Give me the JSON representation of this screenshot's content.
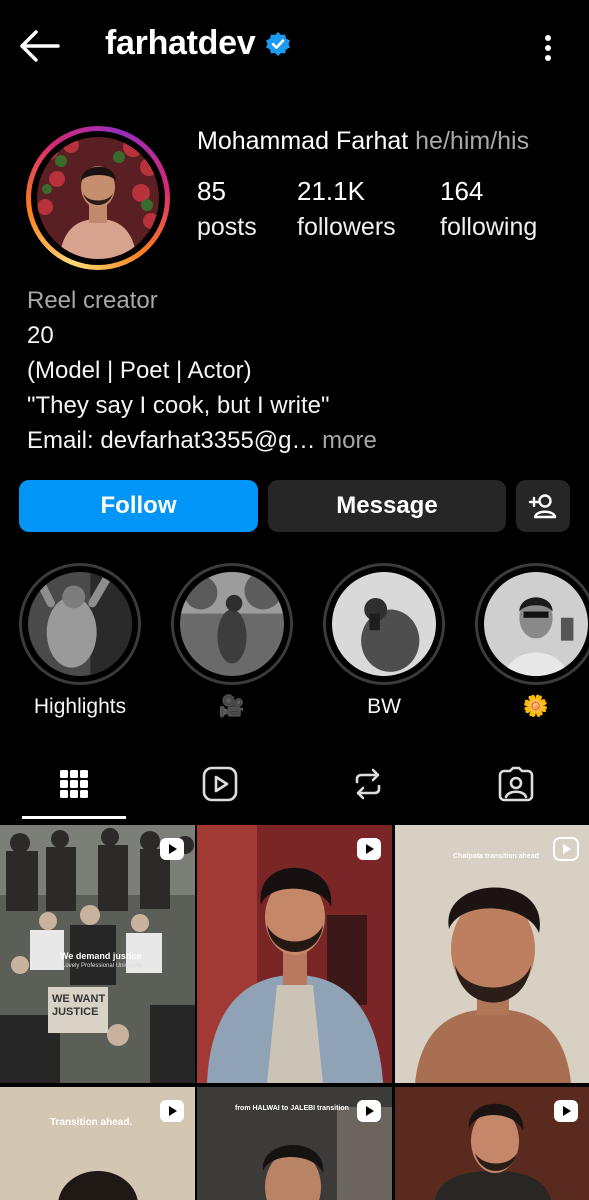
{
  "header": {
    "username": "farhatdev",
    "icons": {
      "back": "arrow-left-icon",
      "verified": "verified-badge-icon",
      "menu": "more-vertical-icon"
    }
  },
  "profile": {
    "full_name": "Mohammad Farhat",
    "pronouns": "he/him/his",
    "stats": [
      {
        "value": "85",
        "label": "posts"
      },
      {
        "value": "21.1K",
        "label": "followers"
      },
      {
        "value": "164",
        "label": "following"
      }
    ],
    "bio": {
      "category": "Reel creator",
      "lines": [
        "20",
        "(Model | Poet | Actor)",
        "\"They say I cook, but I write\""
      ],
      "email_line": "Email: devfarhat3355@g…",
      "more": " more"
    }
  },
  "actions": {
    "follow": "Follow",
    "message": "Message",
    "add_icon": "person-add-icon",
    "colors": {
      "follow": "#0095f6",
      "secondary": "#262626"
    }
  },
  "highlights": [
    {
      "label": "Highlights"
    },
    {
      "label": "🎥"
    },
    {
      "label": "BW"
    },
    {
      "label": "🌼"
    }
  ],
  "tabs": [
    {
      "icon": "grid-icon",
      "active": true
    },
    {
      "icon": "reels-icon",
      "active": false
    },
    {
      "icon": "reposts-icon",
      "active": false
    },
    {
      "icon": "tagged-icon",
      "active": false
    }
  ],
  "grid": [
    {
      "caption": "We demand justice",
      "sub": "Lovely Professional University",
      "sign": "WE WANT JUSTICE",
      "type": "reel"
    },
    {
      "caption": "",
      "type": "reel"
    },
    {
      "caption": "Chatpata transition ahead",
      "type": "reel"
    },
    {
      "caption": "Transition ahead.",
      "type": "reel"
    },
    {
      "caption": "from HALWAI to JALEBI transition",
      "type": "reel"
    },
    {
      "caption": "",
      "type": "reel"
    }
  ]
}
